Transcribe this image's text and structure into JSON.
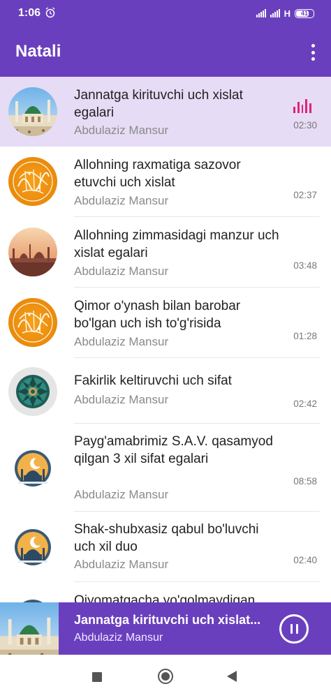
{
  "status_bar": {
    "time": "1:06",
    "network": "H",
    "battery": "41",
    "icons": [
      "alarm-icon",
      "signal-icon",
      "signal-icon",
      "battery-icon"
    ]
  },
  "app_bar": {
    "title": "Natali",
    "menu_icon": "more-vertical-icon"
  },
  "tracks": [
    {
      "title": "Jannatga kirituvchi uch xislat egalari",
      "artist": "Abdulaziz Mansur",
      "duration": "02:30",
      "thumbnail": "mosque-photo",
      "playing": true
    },
    {
      "title": "Allohning raxmatiga sazovor etuvchi uch xislat",
      "artist": "Abdulaziz Mansur",
      "duration": "02:37",
      "thumbnail": "calligraphy-gold"
    },
    {
      "title": "Allohning zimmasidagi manzur uch xislat egalari",
      "artist": "Abdulaziz Mansur",
      "duration": "03:48",
      "thumbnail": "city-sunset"
    },
    {
      "title": "Qimor o'ynash bilan barobar bo'lgan uch ish to'g'risida",
      "artist": "Abdulaziz Mansur",
      "duration": "01:28",
      "thumbnail": "calligraphy-gold"
    },
    {
      "title": "Fakirlik keltiruvchi uch sifat",
      "artist": "Abdulaziz Mansur",
      "duration": "02:42",
      "thumbnail": "ornament-mandala"
    },
    {
      "title": "Payg'amabrimiz S.A.V. qasamyod qilgan 3 xil sifat egalari",
      "artist": "Abdulaziz Mansur",
      "duration": "08:58",
      "thumbnail": "mosque-moon"
    },
    {
      "title": "Shak-shubxasiz qabul bo'luvchi uch xil duo",
      "artist": "Abdulaziz Mansur",
      "duration": "02:40",
      "thumbnail": "mosque-moon"
    },
    {
      "title": "Qiyomatgacha yo'qolmaydigan",
      "artist": "",
      "duration": "",
      "thumbnail": "mosque-moon"
    }
  ],
  "now_playing": {
    "title": "Jannatga kirituvchi uch xislat...",
    "artist": "Abdulaziz Mansur",
    "control_icon": "pause-icon"
  },
  "nav_bar": {
    "icons": [
      "recents-square-icon",
      "home-circle-icon",
      "back-triangle-icon"
    ]
  },
  "colors": {
    "primary": "#6a3fbe",
    "active_row": "#e6dcf5",
    "playing_indicator": "#e0217c"
  }
}
